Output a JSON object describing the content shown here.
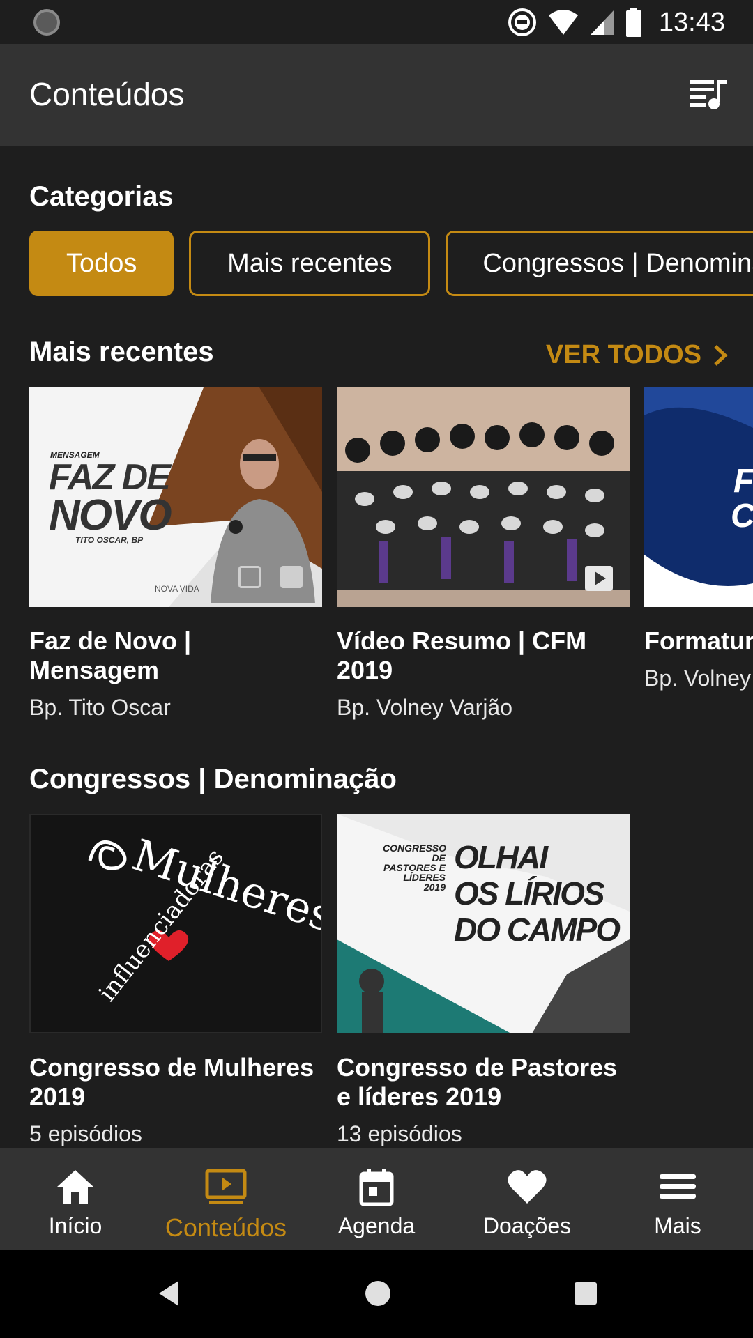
{
  "status_bar": {
    "time": "13:43"
  },
  "app_bar": {
    "title": "Conteúdos"
  },
  "categories": {
    "title": "Categorias",
    "chips": [
      {
        "label": "Todos",
        "active": true
      },
      {
        "label": "Mais recentes",
        "active": false
      },
      {
        "label": "Congressos | Denominação",
        "active": false
      }
    ]
  },
  "recent": {
    "title": "Mais recentes",
    "see_all": "VER TODOS",
    "items": [
      {
        "title": "Faz de Novo | Mensagem",
        "subtitle": "Bp. Tito Oscar",
        "thumb_text": {
          "small_top": "MENSAGEM",
          "line1": "FAZ DE",
          "line2": "NOVO",
          "author": "TITO OSCAR, BP",
          "brand": "NOVA VIDA"
        }
      },
      {
        "title": "Vídeo Resumo | CFM 2019",
        "subtitle": "Bp. Volney Varjão"
      },
      {
        "title": "Formatura",
        "subtitle": "Bp. Volney",
        "thumb_text": {
          "line1": "FO",
          "line2": "CI"
        }
      }
    ]
  },
  "congressos": {
    "title": "Congressos | Denominação",
    "items": [
      {
        "title": "Congresso de Mulheres 2019",
        "subtitle": "5 episódios",
        "thumb_text": {
          "word1": "Mulheres",
          "word2": "influenciadoras"
        }
      },
      {
        "title": "Congresso de Pastores e líderes 2019",
        "subtitle": "13 episódios",
        "thumb_text": {
          "small1": "CONGRESSO DE",
          "small2": "PASTORES E",
          "small3": "LÍDERES",
          "small4": "2019",
          "big1": "OLHAI",
          "big2": "OS LÍRIOS",
          "big3": "DO CAMPO"
        }
      }
    ]
  },
  "bottom_nav": {
    "items": [
      {
        "label": "Início",
        "icon": "home-icon",
        "active": false
      },
      {
        "label": "Conteúdos",
        "icon": "play-screen-icon",
        "active": true
      },
      {
        "label": "Agenda",
        "icon": "calendar-icon",
        "active": false
      },
      {
        "label": "Doações",
        "icon": "heart-icon",
        "active": false
      },
      {
        "label": "Mais",
        "icon": "menu-icon",
        "active": false
      }
    ]
  },
  "colors": {
    "accent": "#c48a13",
    "background": "#1e1e1e",
    "bar": "#333333"
  }
}
